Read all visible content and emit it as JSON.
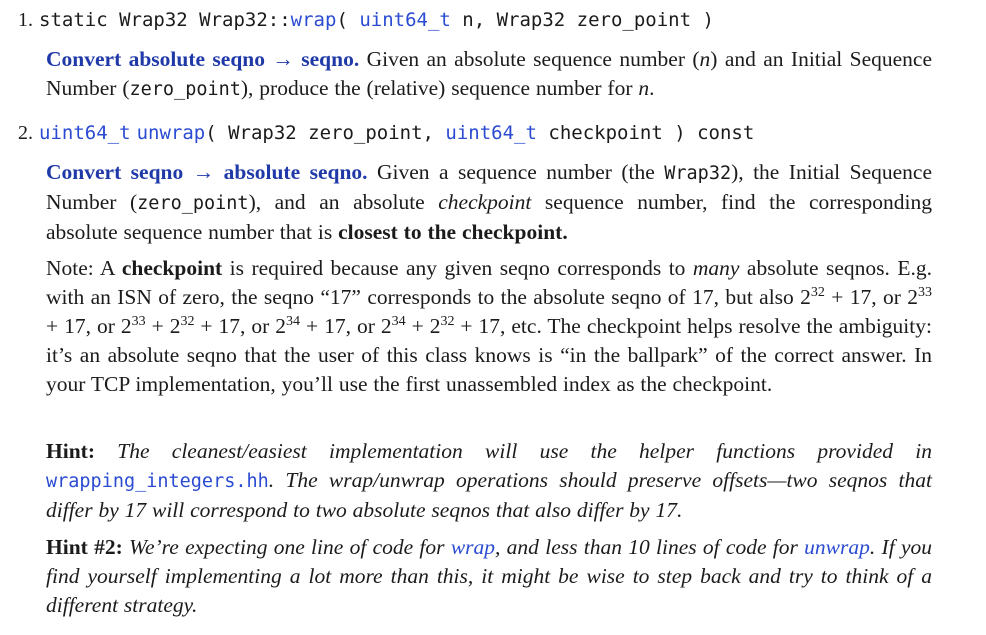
{
  "item1": {
    "number": "1.",
    "sig_a": "static Wrap32 Wrap32::",
    "sig_fn": "wrap",
    "sig_b": "( ",
    "sig_type": "uint64_t",
    "sig_c": " n, Wrap32 zero_point )",
    "desc_title": "Convert absolute seqno → seqno.",
    "desc_a": " Given an absolute sequence number (",
    "desc_n": "n",
    "desc_b": ") and an Initial Sequence Number (",
    "desc_code": "zero_point",
    "desc_c": "), produce the (relative) sequence number for ",
    "desc_n2": "n",
    "desc_d": "."
  },
  "item2": {
    "number": "2.",
    "sig_type": "uint64_t",
    "sig_fn": "unwrap",
    "sig_a": "( Wrap32 zero_point, ",
    "sig_type2": "uint64_t",
    "sig_b": " checkpoint ) const",
    "desc_title": "Convert seqno → absolute seqno.",
    "desc_a": " Given a sequence number (the ",
    "desc_code1": "Wrap32",
    "desc_b": "), the Initial Sequence Number (",
    "desc_code2": "zero_point",
    "desc_c": "), and an absolute ",
    "desc_em": "checkpoint",
    "desc_d": " sequence number, find the corresponding absolute sequence number that is ",
    "desc_bold": "closest to the checkpoint.",
    "note_a": "Note: A ",
    "note_bold": "checkpoint",
    "note_b": " is required because any given seqno corresponds to ",
    "note_em": "many",
    "note_c": " absolute seqnos. E.g. with an ISN of zero, the seqno “17” corresponds to the absolute seqno of 17, but also 2",
    "note_e1": "32",
    "note_d": " + 17, or 2",
    "note_e2": "33",
    "note_e": " + 17, or 2",
    "note_e3": "33",
    "note_f": " + 2",
    "note_e4": "32",
    "note_g": " + 17, or 2",
    "note_e5": "34",
    "note_h": " + 17, or 2",
    "note_e6": "34",
    "note_i": " + 2",
    "note_e7": "32",
    "note_j": " + 17, etc. The checkpoint helps resolve the ambiguity: it’s an absolute seqno that the user of this class knows is “in the ballpark” of the correct answer. In your TCP implementation, you’ll use the first unassembled index as the checkpoint.",
    "hint1_label": "Hint:",
    "hint1_a": " The cleanest/easiest implementation will use the helper functions provided in ",
    "hint1_file": "wrapping_integers.hh",
    "hint1_b": ". The wrap/unwrap operations should preserve offsets—two seqnos that differ by 17 will correspond to two absolute seqnos that also differ by 17.",
    "hint2_label": "Hint #2:",
    "hint2_a": " We’re expecting one line of code for ",
    "hint2_wrap": "wrap",
    "hint2_b": ", and less than 10 lines of code for ",
    "hint2_unwrap": "unwrap",
    "hint2_c": ". If you find yourself implementing a lot more than this, it might be wise to step back and try to think of a different strategy."
  },
  "colors": {
    "title_blue": "#1f39a8",
    "link_blue": "#2a4bd2",
    "text": "#1b1b1b"
  }
}
